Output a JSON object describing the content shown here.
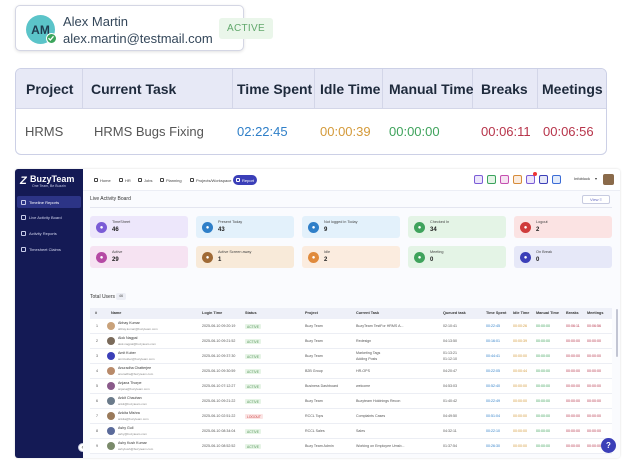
{
  "user": {
    "initials": "AM",
    "name": "Alex Martin",
    "email": "alex.martin@testmail.com",
    "status": "ACTIVE"
  },
  "summary": {
    "headers": [
      "Project",
      "Current Task",
      "Time Spent",
      "Idle Time",
      "Manual Time",
      "Breaks",
      "Meetings"
    ],
    "values": [
      "HRMS",
      "HRMS Bugs Fixing",
      "02:22:45",
      "00:00:39",
      "00:00:00",
      "00:06:11",
      "00:06:56"
    ],
    "colors": [
      "#555555",
      "#555555",
      "#2f7fc8",
      "#d49a3a",
      "#3fa35c",
      "#b7344a",
      "#b7344a"
    ]
  },
  "app": {
    "logo": "BuzyTeam",
    "logo_sub": "One Team, Be Buzzin",
    "sidebar": [
      {
        "label": "Timeline Reports",
        "active": true
      },
      {
        "label": "Live Activity Board",
        "active": false
      },
      {
        "label": "Activity Reports",
        "active": false
      },
      {
        "label": "Timesheet Claims",
        "active": false
      }
    ],
    "nav": [
      {
        "label": "Home",
        "active": false
      },
      {
        "label": "HR",
        "active": false
      },
      {
        "label": "Jobs",
        "active": false
      },
      {
        "label": "Planning",
        "active": false
      },
      {
        "label": "Projects/Workspace",
        "active": false
      },
      {
        "label": "Report",
        "active": true
      }
    ],
    "top_icon_colors": [
      "#7b5cd6",
      "#3aa35c",
      "#c54fb0",
      "#d68c3a",
      "#7b5cd6",
      "#3b3fb8",
      "#3b6cd6"
    ],
    "user_mini": "Infoblock",
    "page_title": "Live Activity Board",
    "view_button": "View ≡",
    "cards": [
      {
        "label": "TimeSheet",
        "value": "46",
        "bg": "#ede7fb",
        "icon": "#7b5cd6"
      },
      {
        "label": "Present Today",
        "value": "43",
        "bg": "#e3f1fb",
        "icon": "#2f7fc8"
      },
      {
        "label": "Not logged in Today",
        "value": "9",
        "bg": "#e3f1fb",
        "icon": "#2f7fc8"
      },
      {
        "label": "Checked In",
        "value": "34",
        "bg": "#e4f4e6",
        "icon": "#3fa35c"
      },
      {
        "label": "Logout",
        "value": "2",
        "bg": "#fbe3e3",
        "icon": "#cf3b3b"
      },
      {
        "label": "Active",
        "value": "29",
        "bg": "#f6e3f2",
        "icon": "#b54aa4"
      },
      {
        "label": "Active Screen away",
        "value": "1",
        "bg": "#f8ead9",
        "icon": "#a06a36"
      },
      {
        "label": "Idle",
        "value": "2",
        "bg": "#fbecdf",
        "icon": "#e08a3c"
      },
      {
        "label": "Meeting",
        "value": "0",
        "bg": "#e4f4e6",
        "icon": "#3fa35c"
      },
      {
        "label": "On Break",
        "value": "0",
        "bg": "#e6e8f8",
        "icon": "#3b3fb8"
      }
    ],
    "total_users_label": "Total Users",
    "total_users_count": "46",
    "grid_headers": [
      "#",
      "Name",
      "Login Time",
      "Status",
      "Project",
      "Current Task",
      "Queued task",
      "Time Spent",
      "Idle Time",
      "Manual Time",
      "Breaks",
      "Meetings"
    ],
    "rows": [
      {
        "n": "1",
        "name": "Abhay Kumar",
        "email": "abhay.kumar@buzyteam.com",
        "login": "2025-06-10 09:20:19",
        "status": "ACTIVE",
        "project": "Buzy Team",
        "task": "BuzyTeam TestFor HRMS A...",
        "queued": "02:10:41",
        "spent": "00:22:45",
        "idle": "00:00:26",
        "manual": "00:00:00",
        "breaks": "00:06:11",
        "meet": "00:06:56",
        "avatar": "#c9a27a"
      },
      {
        "n": "2",
        "name": "Alok Nagpal",
        "email": "alok.nagpal@buzyteam.com",
        "login": "2025-06-10 09:21:52",
        "status": "ACTIVE",
        "project": "Buzy Team",
        "task": "Redesign",
        "queued": "04:13:50",
        "spent": "00:16:01",
        "idle": "00:00:39",
        "manual": "00:00:00",
        "breaks": "00:00:00",
        "meet": "00:00:00",
        "avatar": "#7a6a5a"
      },
      {
        "n": "3",
        "name": "Amit Kuber",
        "email": "amit.kuber@buzyteam.com",
        "login": "2025-06-10 09:37:30",
        "status": "ACTIVE",
        "project": "Buzy Team",
        "task": "Marketing Tags",
        "queued": "01:13:21",
        "spent": "00:44:41",
        "idle": "00:00:00",
        "manual": "00:00:00",
        "breaks": "00:00:00",
        "meet": "00:00:00",
        "avatar": "#3b3fb8",
        "task2": "Adding Posts",
        "queued2": "01:12:10"
      },
      {
        "n": "4",
        "name": "Anuradha Chatterjee",
        "email": "anuradha@buzyteam.com",
        "login": "2025-06-10 09:30:59",
        "status": "ACTIVE",
        "project": "B2B Group",
        "task": "HR-OPS",
        "queued": "04:20:47",
        "spent": "00:22:05",
        "idle": "00:00:44",
        "manual": "00:00:00",
        "breaks": "00:00:00",
        "meet": "00:00:00",
        "avatar": "#b88a6a"
      },
      {
        "n": "5",
        "name": "Anjana Thorpe",
        "email": "anjana@buzyteam.com",
        "login": "2025-06-10 07:12:27",
        "status": "ACTIVE",
        "project": "Business Dashboard",
        "task": "welcome",
        "queued": "04:53:03",
        "spent": "00:52:40",
        "idle": "00:00:00",
        "manual": "00:00:00",
        "breaks": "00:00:00",
        "meet": "00:00:00",
        "avatar": "#8a5a8a"
      },
      {
        "n": "6",
        "name": "Ankit Chauhan",
        "email": "ankit@buzyteam.com",
        "login": "2025-06-10 09:21:22",
        "status": "ACTIVE",
        "project": "Buzy Team",
        "task": "Buzyteam Holdnings Recon",
        "queued": "01:40:42",
        "spent": "00:22:49",
        "idle": "00:00:00",
        "manual": "00:00:00",
        "breaks": "00:00:00",
        "meet": "00:00:00",
        "avatar": "#6a7a8a"
      },
      {
        "n": "7",
        "name": "Ankita Mishra",
        "email": "ankita@buzyteam.com",
        "login": "2025-06-10 02:51:22",
        "status": "LOGOUT",
        "project": "RCCL Tops",
        "task": "Complaints Cases",
        "queued": "04:49:50",
        "spent": "00:51:04",
        "idle": "00:00:00",
        "manual": "00:00:00",
        "breaks": "00:00:00",
        "meet": "00:00:00",
        "avatar": "#9a7a5a"
      },
      {
        "n": "8",
        "name": "Ashy Gull",
        "email": "ashy@buzyteam.com",
        "login": "2025-06-10 08:34:04",
        "status": "ACTIVE",
        "project": "RCCL Sales",
        "task": "Sales",
        "queued": "04:32:11",
        "spent": "00:22:10",
        "idle": "00:00:00",
        "manual": "00:00:00",
        "breaks": "00:00:00",
        "meet": "00:00:00",
        "avatar": "#5a6a9a"
      },
      {
        "n": "9",
        "name": "Ashy Kush Kumar",
        "email": "ashykush@buzyteam.com",
        "login": "2025-06-10 08:52:52",
        "status": "ACTIVE",
        "project": "Buzy Team Admin",
        "task": "Working on Employee Umsb...",
        "queued": "01:37:54",
        "spent": "00:26:30",
        "idle": "00:00:00",
        "manual": "00:00:00",
        "breaks": "00:00:00",
        "meet": "00:00:00",
        "avatar": "#7a8a6a"
      }
    ],
    "help": "?"
  }
}
